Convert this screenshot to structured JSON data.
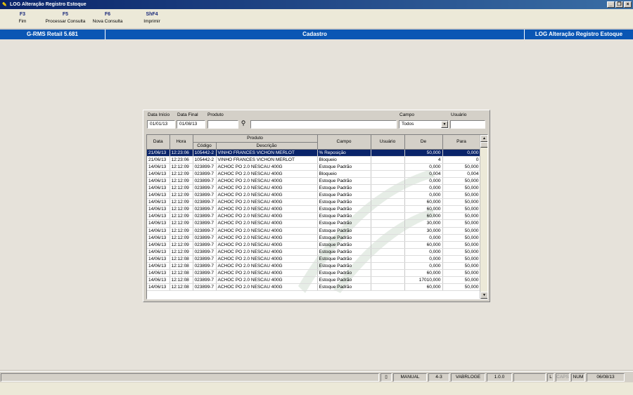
{
  "window": {
    "title": "LOG Alteração Registro Estoque"
  },
  "toolbar": [
    {
      "key": "F3",
      "label": "Fim"
    },
    {
      "key": "F5",
      "label": "Processar Consulta"
    },
    {
      "key": "F6",
      "label": "Nova Consulta"
    },
    {
      "key": "ShF4",
      "label": "Imprimir"
    }
  ],
  "header": {
    "app": "G-RMS Retail 5.681",
    "section": "Cadastro",
    "screen": "LOG Alteração Registro Estoque"
  },
  "filters": {
    "data_inicio_label": "Data Início",
    "data_inicio": "01/01/13",
    "data_final_label": "Data Final",
    "data_final": "01/08/13",
    "produto_label": "Produto",
    "produto": "",
    "produto_desc": "",
    "campo_label": "Campo",
    "campo": "Todos",
    "usuario_label": "Usuário",
    "usuario": ""
  },
  "grid": {
    "headers": {
      "data": "Data",
      "hora": "Hora",
      "produto": "Produto",
      "codigo": "Código",
      "descricao": "Descrição",
      "campo": "Campo",
      "usuario": "Usuário",
      "de": "De",
      "para": "Para"
    },
    "rows": [
      [
        "21/06/13",
        "12:23:06",
        "105442-2",
        "VINHO FRANCES VICHON MERLOT",
        "% Reposição",
        "",
        "50,000",
        "0,000"
      ],
      [
        "21/06/13",
        "12:23:06",
        "105442-2",
        "VINHO FRANCES VICHON MERLOT",
        "Bloqueio",
        "",
        "4",
        "0"
      ],
      [
        "14/06/13",
        "12:12:09",
        "023899-7",
        "ACHOC PO 2.0 NESCAU 400G",
        "Estoque Padrão",
        "",
        "0,000",
        "50,000"
      ],
      [
        "14/06/13",
        "12:12:09",
        "023899-7",
        "ACHOC PO 2.0 NESCAU 400G",
        "Bloqueio",
        "",
        "0,004",
        "0,004"
      ],
      [
        "14/06/13",
        "12:12:09",
        "023899-7",
        "ACHOC PO 2.0 NESCAU 400G",
        "Estoque Padrão",
        "",
        "0,000",
        "50,000"
      ],
      [
        "14/06/13",
        "12:12:09",
        "023899-7",
        "ACHOC PO 2.0 NESCAU 400G",
        "Estoque Padrão",
        "",
        "0,000",
        "50,000"
      ],
      [
        "14/06/13",
        "12:12:09",
        "023899-7",
        "ACHOC PO 2.0 NESCAU 400G",
        "Estoque Padrão",
        "",
        "0,000",
        "50,000"
      ],
      [
        "14/06/13",
        "12:12:09",
        "023899-7",
        "ACHOC PO 2.0 NESCAU 400G",
        "Estoque Padrão",
        "",
        "60,000",
        "50,000"
      ],
      [
        "14/06/13",
        "12:12:09",
        "023899-7",
        "ACHOC PO 2.0 NESCAU 400G",
        "Estoque Padrão",
        "",
        "60,000",
        "50,000"
      ],
      [
        "14/06/13",
        "12:12:09",
        "023899-7",
        "ACHOC PO 2.0 NESCAU 400G",
        "Estoque Padrão",
        "",
        "60,000",
        "50,000"
      ],
      [
        "14/06/13",
        "12:12:09",
        "023899-7",
        "ACHOC PO 2.0 NESCAU 400G",
        "Estoque Padrão",
        "",
        "30,000",
        "50,000"
      ],
      [
        "14/06/13",
        "12:12:09",
        "023899-7",
        "ACHOC PO 2.0 NESCAU 400G",
        "Estoque Padrão",
        "",
        "30,000",
        "50,000"
      ],
      [
        "14/06/13",
        "12:12:09",
        "023899-7",
        "ACHOC PO 2.0 NESCAU 400G",
        "Estoque Padrão",
        "",
        "0,000",
        "50,000"
      ],
      [
        "14/06/13",
        "12:12:09",
        "023899-7",
        "ACHOC PO 2.0 NESCAU 400G",
        "Estoque Padrão",
        "",
        "60,000",
        "50,000"
      ],
      [
        "14/06/13",
        "12:12:09",
        "023899-7",
        "ACHOC PO 2.0 NESCAU 400G",
        "Estoque Padrão",
        "",
        "0,000",
        "50,000"
      ],
      [
        "14/06/13",
        "12:12:08",
        "023899-7",
        "ACHOC PO 2.0 NESCAU 400G",
        "Estoque Padrão",
        "",
        "0,000",
        "50,000"
      ],
      [
        "14/06/13",
        "12:12:08",
        "023899-7",
        "ACHOC PO 2.0 NESCAU 400G",
        "Estoque Padrão",
        "",
        "0,000",
        "50,000"
      ],
      [
        "14/06/13",
        "12:12:08",
        "023899-7",
        "ACHOC PO 2.0 NESCAU 400G",
        "Estoque Padrão",
        "",
        "60,000",
        "50,000"
      ],
      [
        "14/06/13",
        "12:12:08",
        "023899-7",
        "ACHOC PO 2.0 NESCAU 400G",
        "Estoque Padrão",
        "",
        "17010,000",
        "50,000"
      ],
      [
        "14/06/13",
        "12:12:08",
        "023899-7",
        "ACHOC PO 2.0 NESCAU 400G",
        "Estoque Padrão",
        "",
        "60,000",
        "50,000"
      ]
    ]
  },
  "status": {
    "mode": "MANUAL",
    "code": "4-3",
    "program": "VABRLOGE",
    "version": "1.0.0",
    "l": "L",
    "caps": "CAPS",
    "num": "NUM",
    "date": "06/08/13"
  },
  "colors": {
    "header": "#0a56b4",
    "selected_row": "#0a246a",
    "title_bar": "#0a246a"
  }
}
